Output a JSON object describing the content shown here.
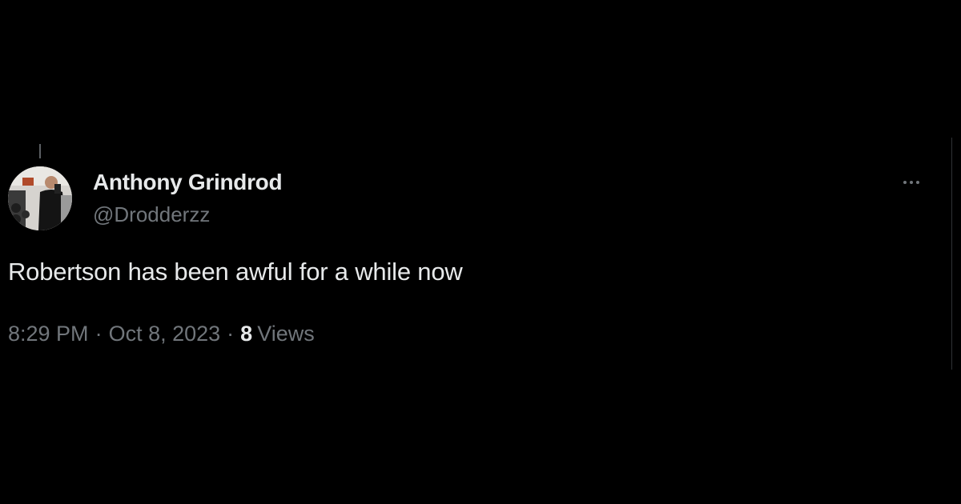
{
  "tweet": {
    "author_name": "Anthony Grindrod",
    "author_handle": "@Drodderzz",
    "text": "Robertson has been awful for a while now",
    "time": "8:29 PM",
    "separator": "·",
    "date": "Oct 8, 2023",
    "views_count": "8",
    "views_label": "Views"
  },
  "icons": {
    "more": "more-horizontal-icon",
    "avatar": "profile-avatar"
  },
  "colors": {
    "background": "#000000",
    "primary_text": "#e7e9ea",
    "secondary_text": "#71767b",
    "divider": "#2f3336"
  }
}
